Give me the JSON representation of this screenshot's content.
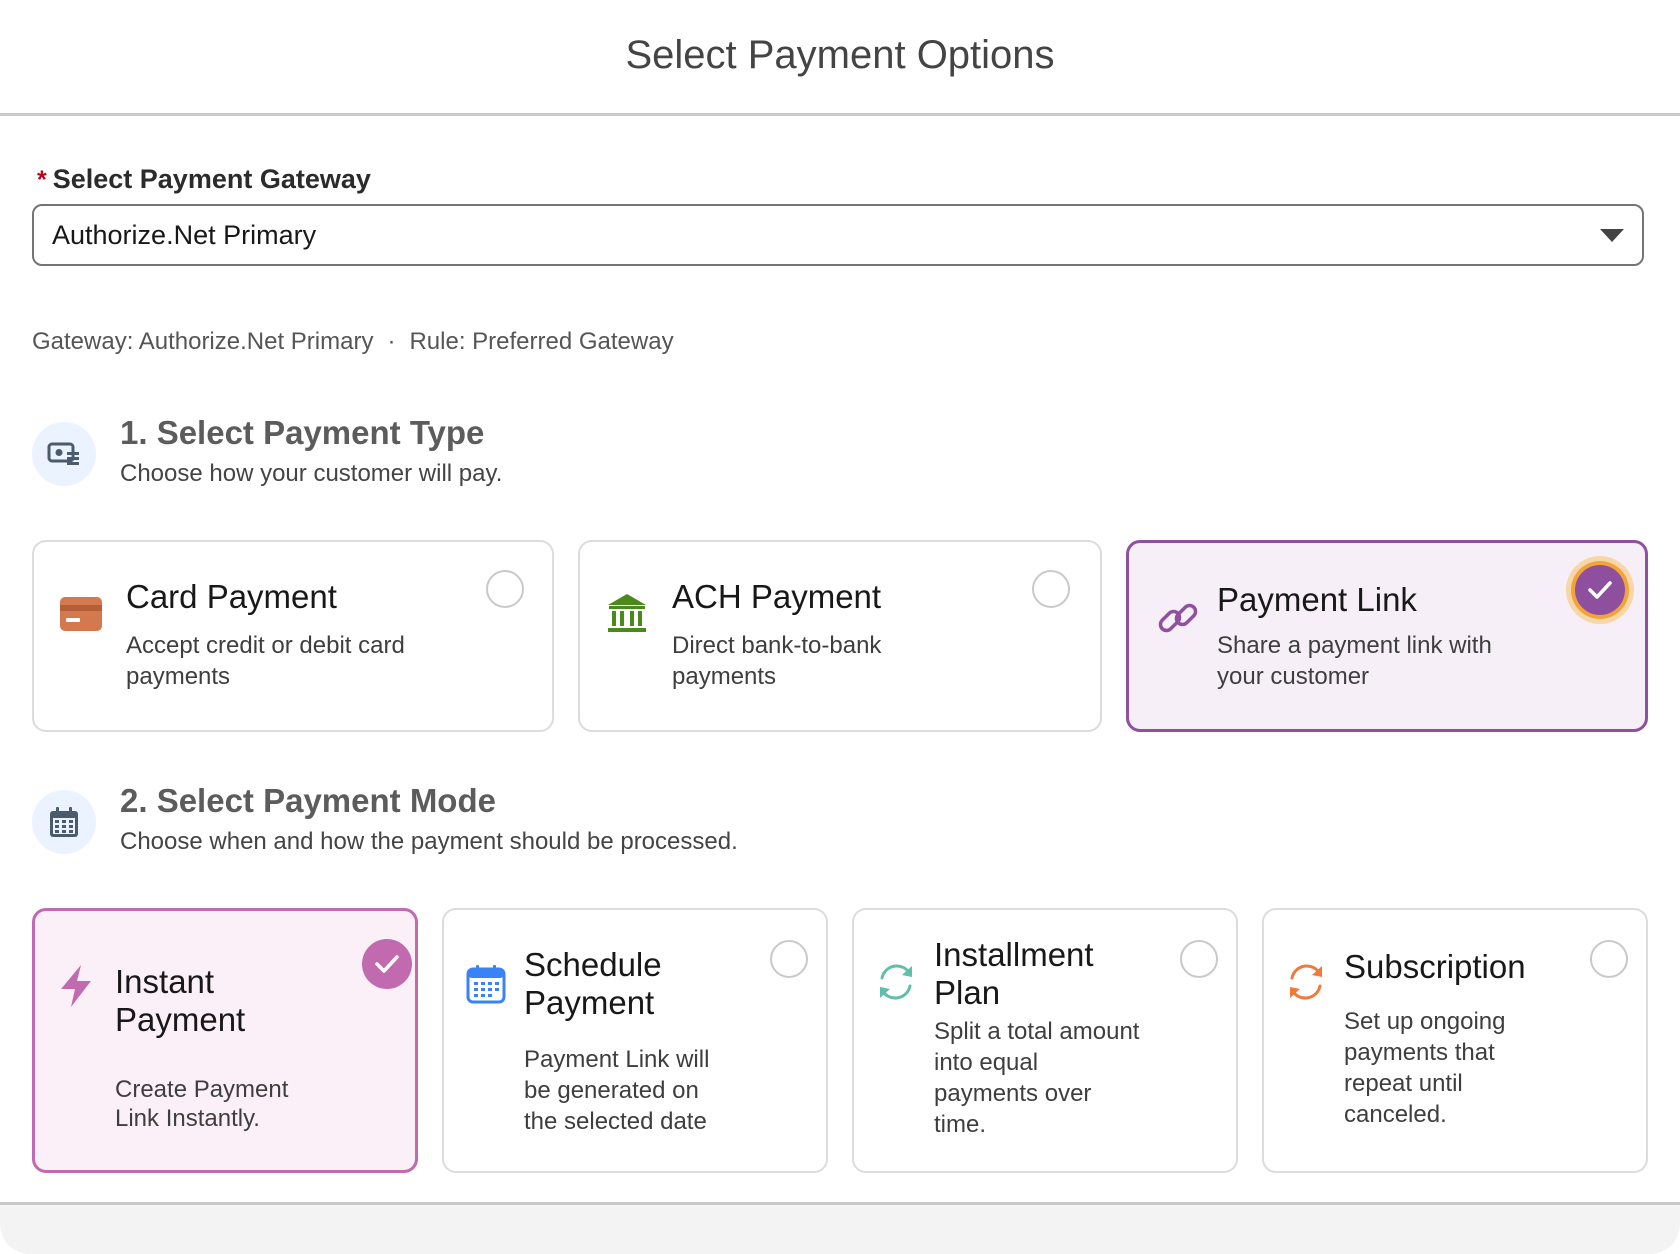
{
  "modal": {
    "title": "Select Payment Options"
  },
  "gateway": {
    "required_mark": "*",
    "label": "Select Payment Gateway",
    "selected": "Authorize.Net Primary",
    "info_gateway": "Gateway: Authorize.Net Primary",
    "info_separator": "·",
    "info_rule": "Rule: Preferred Gateway"
  },
  "payment_type": {
    "title": "1. Select Payment Type",
    "subtitle": "Choose how your customer will pay.",
    "options": [
      {
        "title": "Card Payment",
        "desc_line1": "Accept credit or debit card",
        "desc_line2": "payments",
        "selected": false,
        "icon": "credit-card-icon"
      },
      {
        "title": "ACH Payment",
        "desc_line1": "Direct bank-to-bank",
        "desc_line2": "payments",
        "selected": false,
        "icon": "bank-icon"
      },
      {
        "title": "Payment Link",
        "desc_line1": "Share a payment link with",
        "desc_line2": "your customer",
        "selected": true,
        "icon": "link-icon"
      }
    ]
  },
  "payment_mode": {
    "title": "2. Select Payment Mode",
    "subtitle": "Choose when and how the payment should be processed.",
    "options": [
      {
        "title_line1": "Instant",
        "title_line2": "Payment",
        "desc": [
          "Create Payment",
          "Link Instantly."
        ],
        "selected": true,
        "icon": "lightning-icon"
      },
      {
        "title_line1": "Schedule",
        "title_line2": "Payment",
        "desc": [
          "Payment Link will",
          "be generated on",
          "the selected date"
        ],
        "selected": false,
        "icon": "calendar-icon"
      },
      {
        "title_line1": "Installment",
        "title_line2": "Plan",
        "desc": [
          "Split a total amount",
          "into equal",
          "payments over",
          "time."
        ],
        "selected": false,
        "icon": "refresh-icon"
      },
      {
        "title_line1": "Subscription",
        "title_line2": "",
        "desc": [
          "Set up ongoing",
          "payments that",
          "repeat until",
          "canceled."
        ],
        "selected": false,
        "icon": "recurring-icon"
      }
    ]
  },
  "colors": {
    "selected_purple": "#8e4f9e",
    "selected_pink": "#c26ab0",
    "focus_ring": "#f2a43a"
  }
}
